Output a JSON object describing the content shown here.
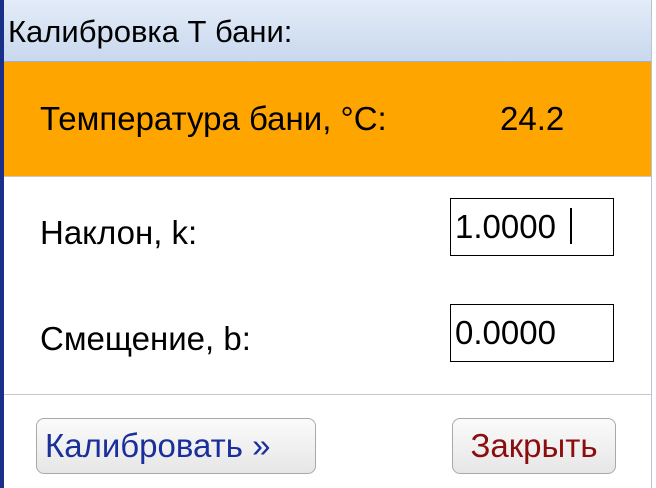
{
  "window": {
    "title": "Калибровка Т бани:"
  },
  "temperature": {
    "label": "Температура бани, °C:",
    "value": "24.2"
  },
  "slope": {
    "label": "Наклон, k:",
    "value": "1.0000"
  },
  "offset": {
    "label": "Смещение, b:",
    "value": "0.0000"
  },
  "buttons": {
    "calibrate_label": "Калибровать  »",
    "close_label": "Закрыть"
  },
  "colors": {
    "header_bar": "#ffa500",
    "titlebar": "#c9d8ee",
    "window_border": "#1a2f8a",
    "calibrate_text": "#1a2f9a",
    "close_text": "#8b0d0d"
  }
}
